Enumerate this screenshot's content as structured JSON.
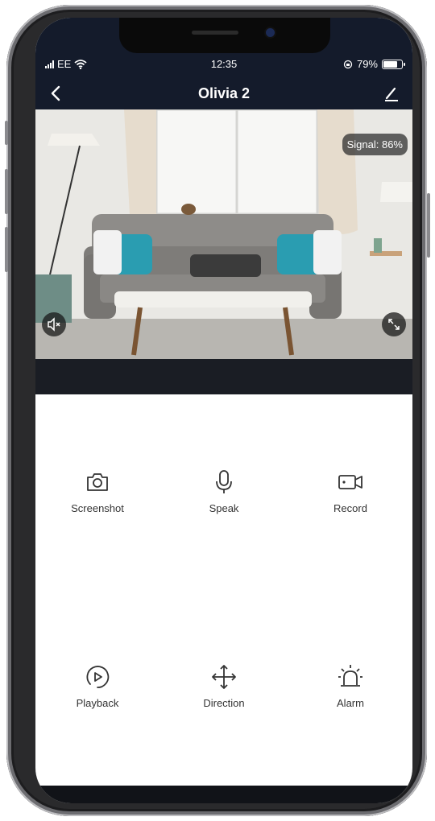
{
  "status_bar": {
    "carrier": "EE",
    "time": "12:35",
    "battery_percent": "79%",
    "battery_level": 0.79
  },
  "header": {
    "title": "Olivia 2"
  },
  "video": {
    "signal_label": "Signal: 86%"
  },
  "controls": [
    {
      "label": "Screenshot",
      "icon": "camera-icon"
    },
    {
      "label": "Speak",
      "icon": "microphone-icon"
    },
    {
      "label": "Record",
      "icon": "video-camera-icon"
    },
    {
      "label": "Playback",
      "icon": "playback-icon"
    },
    {
      "label": "Direction",
      "icon": "direction-arrows-icon"
    },
    {
      "label": "Alarm",
      "icon": "alarm-siren-icon"
    }
  ],
  "colors": {
    "header_bg": "#141b2b",
    "icon_color": "#333333"
  }
}
